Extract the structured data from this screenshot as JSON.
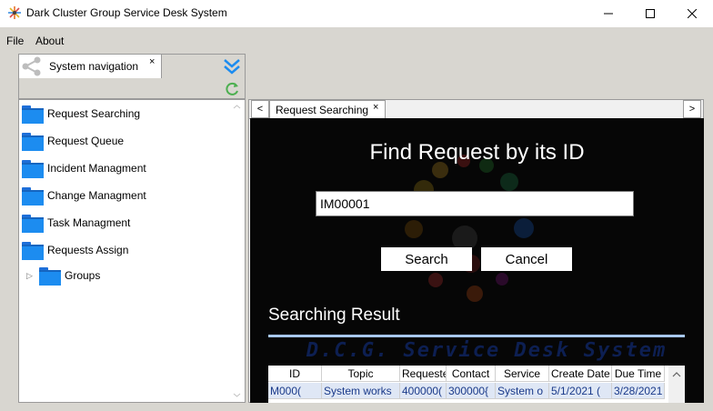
{
  "window": {
    "title": "Dark Cluster Group Service Desk System"
  },
  "menu": {
    "file": "File",
    "about": "About"
  },
  "nav": {
    "tab_label": "System navigation",
    "tab_close": "×",
    "items": [
      {
        "label": "Request Searching"
      },
      {
        "label": "Request Queue"
      },
      {
        "label": "Incident Managment"
      },
      {
        "label": "Change Managment"
      },
      {
        "label": "Task Managment"
      },
      {
        "label": "Requests Assign"
      },
      {
        "label": "Groups"
      }
    ]
  },
  "doc": {
    "tab_label": "Request Searching",
    "tab_close": "×",
    "left_arrow": "<",
    "right_arrow": ">"
  },
  "search": {
    "heading": "Find Request by its ID",
    "value": "IM00001",
    "search_button": "Search",
    "cancel_button": "Cancel"
  },
  "results": {
    "title": "Searching Result",
    "watermark": "D.C.G. Service Desk System",
    "columns": [
      "ID",
      "Topic",
      "Requeste",
      "Contact",
      "Service",
      "Create Date",
      "Due Time"
    ],
    "rows": [
      [
        "M000(",
        "System works",
        "400000(",
        "300000{",
        "System o",
        "5/1/2021 (",
        "3/28/2021"
      ]
    ]
  },
  "colors": {
    "accent": "#1c8cf0",
    "content_bg": "#060606",
    "result_line": "#a8c8f0"
  },
  "icons": {
    "app": "colorful-starburst-icon",
    "nav": "share-icon",
    "collapse": "double-chevron-down-icon",
    "refresh": "refresh-icon",
    "folder": "folder-icon"
  }
}
